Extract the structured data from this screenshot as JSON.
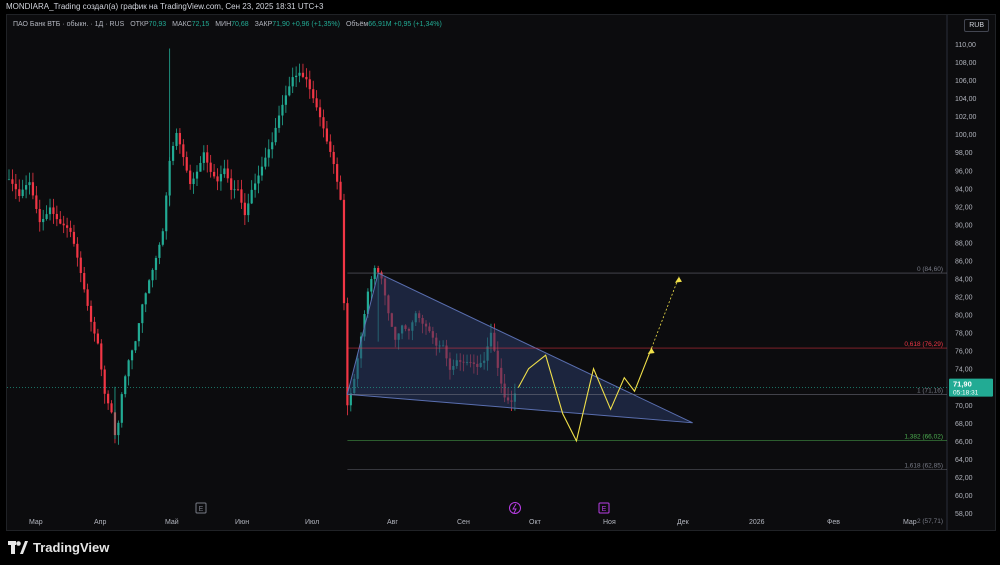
{
  "header": {
    "title": "MONDIARA_Trading создал(а) график на TradingView.com, Сен 23, 2025 18:31 UTC+3"
  },
  "legend": {
    "symbol": "ПАО Банк ВТБ · обыкн. · 1Д · RUS",
    "open_label": "ОТКР",
    "open": "70,93",
    "high_label": "МАКС",
    "high": "72,15",
    "low_label": "МИН",
    "low": "70,68",
    "close_label": "ЗАКР",
    "close": "71,90 +0,96 (+1,35%)",
    "volume_label": "Объём",
    "volume": "66,91M",
    "volume_change": "+0,95 (+1,34%)"
  },
  "currency_button": "RUB",
  "price_badge": {
    "price": "71,90",
    "countdown": "05:18:31"
  },
  "footer": {
    "brand": "TradingView"
  },
  "event_markers": [
    "E",
    "E"
  ],
  "colors": {
    "up": "#22ab94",
    "down": "#f23645",
    "triangle_fill": "#2a3a66",
    "triangle_stroke": "#5a6fb0",
    "projection": "#f0e04a",
    "fib_red": "#f23645",
    "fib_green": "#4caf50"
  },
  "chart_data": {
    "type": "candlestick",
    "title": "",
    "ylim": [
      58,
      111
    ],
    "y_ticks": [
      "58,00",
      "60,00",
      "62,00",
      "64,00",
      "66,00",
      "68,00",
      "70,00",
      "72,00",
      "74,00",
      "76,00",
      "78,00",
      "80,00",
      "82,00",
      "84,00",
      "86,00",
      "88,00",
      "90,00",
      "92,00",
      "94,00",
      "96,00",
      "98,00",
      "100,00",
      "102,00",
      "104,00",
      "106,00",
      "108,00",
      "110,00"
    ],
    "x_ticks": [
      "Мар",
      "Апр",
      "Май",
      "Июн",
      "Июл",
      "Авг",
      "Сен",
      "Окт",
      "Ноя",
      "Дек",
      "2026",
      "Фев",
      "Мар"
    ],
    "price_path": [
      [
        0,
        95
      ],
      [
        3,
        92
      ],
      [
        6,
        94
      ],
      [
        9,
        91
      ],
      [
        12,
        93
      ],
      [
        15,
        90
      ],
      [
        18,
        88
      ],
      [
        21,
        84
      ],
      [
        24,
        80
      ],
      [
        26,
        78
      ],
      [
        28,
        72
      ],
      [
        30,
        69
      ],
      [
        31,
        66
      ],
      [
        32,
        67
      ],
      [
        33,
        70
      ],
      [
        35,
        74
      ],
      [
        37,
        77
      ],
      [
        39,
        82
      ],
      [
        41,
        85
      ],
      [
        43,
        87
      ],
      [
        45,
        89
      ],
      [
        47,
        96
      ],
      [
        49,
        99
      ],
      [
        51,
        97
      ],
      [
        53,
        95
      ],
      [
        55,
        97
      ],
      [
        57,
        99
      ],
      [
        59,
        96
      ],
      [
        61,
        94
      ],
      [
        63,
        95
      ],
      [
        65,
        93
      ],
      [
        67,
        94
      ],
      [
        69,
        92
      ],
      [
        71,
        95
      ],
      [
        73,
        96
      ],
      [
        75,
        97
      ],
      [
        77,
        98
      ],
      [
        79,
        101
      ],
      [
        81,
        104
      ],
      [
        83,
        107
      ],
      [
        85,
        108
      ],
      [
        87,
        107
      ],
      [
        89,
        104
      ],
      [
        91,
        101
      ],
      [
        93,
        98
      ],
      [
        95,
        96
      ],
      [
        97,
        93
      ],
      [
        99,
        71
      ],
      [
        101,
        74
      ],
      [
        103,
        78
      ],
      [
        105,
        82
      ],
      [
        107,
        84
      ],
      [
        109,
        83
      ],
      [
        111,
        80
      ],
      [
        113,
        78
      ],
      [
        115,
        80
      ],
      [
        117,
        79
      ],
      [
        119,
        80
      ],
      [
        121,
        78
      ],
      [
        123,
        77
      ],
      [
        125,
        76
      ],
      [
        127,
        77
      ],
      [
        129,
        75
      ],
      [
        131,
        76
      ],
      [
        133,
        75
      ],
      [
        135,
        74
      ],
      [
        137,
        73
      ],
      [
        139,
        74
      ],
      [
        141,
        78
      ],
      [
        143,
        75
      ],
      [
        145,
        72
      ],
      [
        147,
        71
      ],
      [
        149,
        71.9
      ]
    ],
    "fib_levels": [
      {
        "label": "0 (84,60)",
        "value": 84.6,
        "color": "#787b86"
      },
      {
        "label": "0,618 (76,29)",
        "value": 76.29,
        "color": "#f23645"
      },
      {
        "label": "1 (71,16)",
        "value": 71.16,
        "color": "#787b86"
      },
      {
        "label": "1,382 (66,02)",
        "value": 66.02,
        "color": "#4caf50"
      },
      {
        "label": "1,618 (62,85)",
        "value": 62.85,
        "color": "#787b86"
      },
      {
        "label": "2 (57,71)",
        "value": 57.71,
        "color": "#787b86"
      }
    ],
    "triangle": {
      "a": [
        99,
        71.16
      ],
      "b": [
        108,
        84.6
      ],
      "c": [
        200,
        68.0
      ]
    },
    "projection_path": [
      [
        149,
        71.9
      ],
      [
        152,
        74
      ],
      [
        157,
        75.5
      ],
      [
        162,
        69
      ],
      [
        166,
        66
      ],
      [
        171,
        74
      ],
      [
        176,
        69.5
      ],
      [
        180,
        73
      ],
      [
        183,
        71.5
      ],
      [
        188,
        76.3
      ]
    ],
    "projection_arrow": [
      [
        188,
        76.3
      ],
      [
        196,
        84.2
      ]
    ],
    "last_price": 71.9
  }
}
